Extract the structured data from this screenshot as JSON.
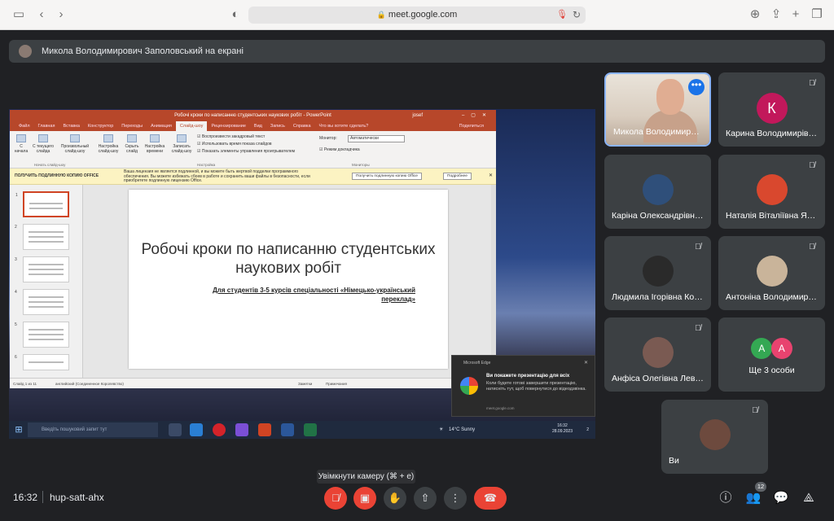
{
  "browser": {
    "url": "meet.google.com"
  },
  "presenting_bar": {
    "text": "Микола Володимирович Заполовський на екрані"
  },
  "powerpoint": {
    "window_title": "Робочі кроки по написанню студентських наукових робіт - PowerPoint",
    "user": "josef",
    "tabs": [
      "Файл",
      "Главная",
      "Вставка",
      "Конструктор",
      "Переходы",
      "Анимация",
      "Слайд-шоу",
      "Рецензирование",
      "Вид",
      "Запись",
      "Справка",
      "Что вы хотите сделать?"
    ],
    "active_tab": "Слайд-шоу",
    "share_label": "Поделиться",
    "ribbon": {
      "buttons": [
        "С начала",
        "С текущего слайда",
        "Произвольный слайд-шоу",
        "Настройка слайд-шоу",
        "Скрыть слайд",
        "Настройка времени",
        "Записать слайд-шоу"
      ],
      "checks": [
        "Воспроизвести закадровый текст",
        "Использовать время показа слайдов",
        "Показать элементы управления проигрывателем"
      ],
      "monitor_label": "Монитор:",
      "monitor_value": "Автоматически",
      "presenter_mode": "Режим докладчика",
      "group_start": "Начать слайд-шоу",
      "group_settings": "Настройка",
      "group_monitors": "Мониторы"
    },
    "warning": {
      "title": "ПОЛУЧИТЬ ПОДЛИННУЮ КОПИЮ OFFICE",
      "text": "Ваша лицензия не является подлинной, и вы можете быть жертвой подделки программного обеспечения. Вы можете избежать сбоев в работе и сохранить ваши файлы в безопасности, если приобретете подлинную лицензию Office.",
      "button_get": "Получить подлинную копию Office",
      "button_more": "Подробнее"
    },
    "slide": {
      "title": "Робочі кроки по написанню студентських наукових робіт",
      "subtitle": "Для студентів 3-5 курсів спеціальності «Німецько-український переклад»"
    },
    "thumb_numbers": [
      "1",
      "2",
      "3",
      "4",
      "5",
      "6"
    ],
    "status": {
      "slide": "Слайд 1 из 11",
      "language": "английский (Соединенное Королевство)",
      "notes": "Заметки",
      "comments": "Примечания"
    }
  },
  "windows": {
    "search_placeholder": "Введіть пошуковий запит тут",
    "weather": "14°C Sunny",
    "time": "16:32",
    "date": "28.09.2023",
    "notif_count": "2"
  },
  "toast": {
    "app": "Microsoft Edge",
    "title": "Ви покажете презентацію для всіх",
    "body": "Коли будете готові завершити презентацію, натисніть тут, щоб повернутися до відеодзвінка.",
    "source": "meet.google.com"
  },
  "participants": [
    {
      "name": "Микола Володимир…",
      "active": true
    },
    {
      "name": "Карина Володимирів…",
      "letter": "К",
      "muted": true
    },
    {
      "name": "Каріна Олександрівн…",
      "muted": false
    },
    {
      "name": "Наталія Віталіївна Яр…",
      "muted": true
    },
    {
      "name": "Людмила Ігорівна Ко…",
      "muted": true
    },
    {
      "name": "Антоніна Володимирі…",
      "muted": true
    },
    {
      "name": "Анфіса Олегівна Лев…",
      "muted": true
    },
    {
      "name": "Ще 3 особи",
      "letters": [
        "А",
        "А"
      ]
    },
    {
      "name": "Ви",
      "muted": true
    }
  ],
  "controls": {
    "tooltip": "Увімкнути камеру (⌘ + e)",
    "time": "16:32",
    "meeting_code": "hup-satt-ahx",
    "people_count": "12"
  }
}
